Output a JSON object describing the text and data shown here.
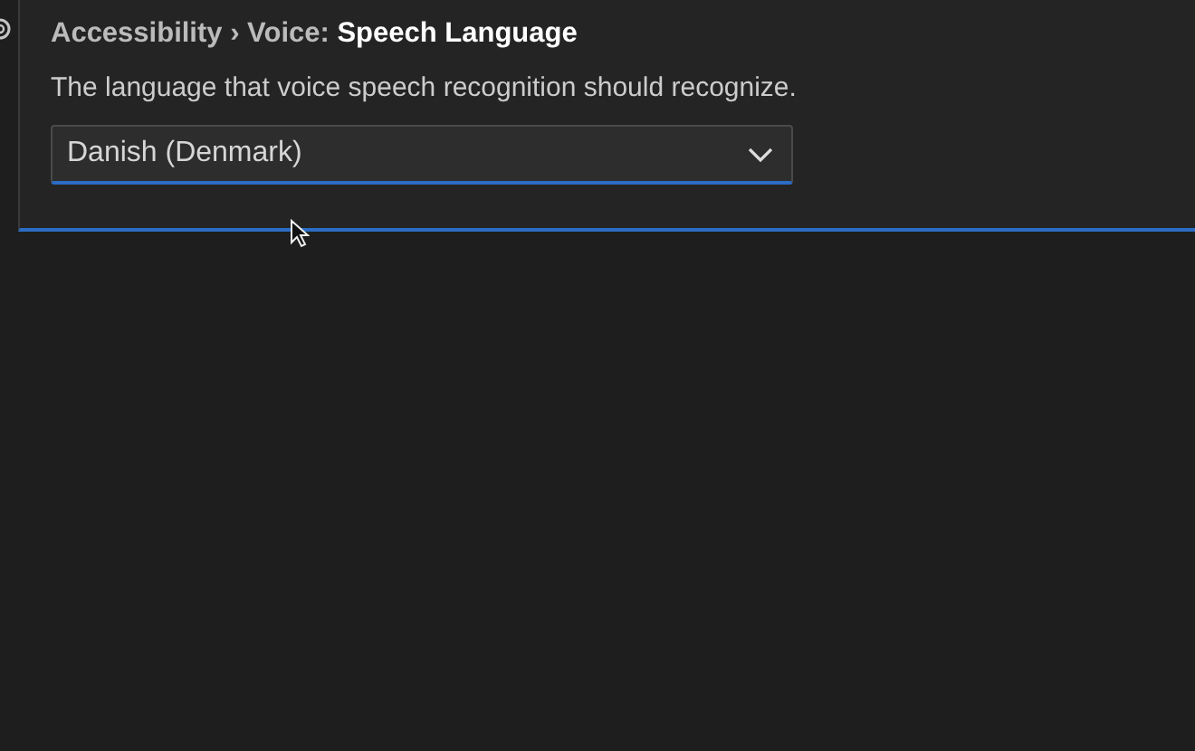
{
  "setting": {
    "category": "Accessibility › Voice: ",
    "title": "Speech Language",
    "description": "The language that voice speech recognition should recognize.",
    "dropdown": {
      "value": "Danish (Denmark)"
    }
  }
}
